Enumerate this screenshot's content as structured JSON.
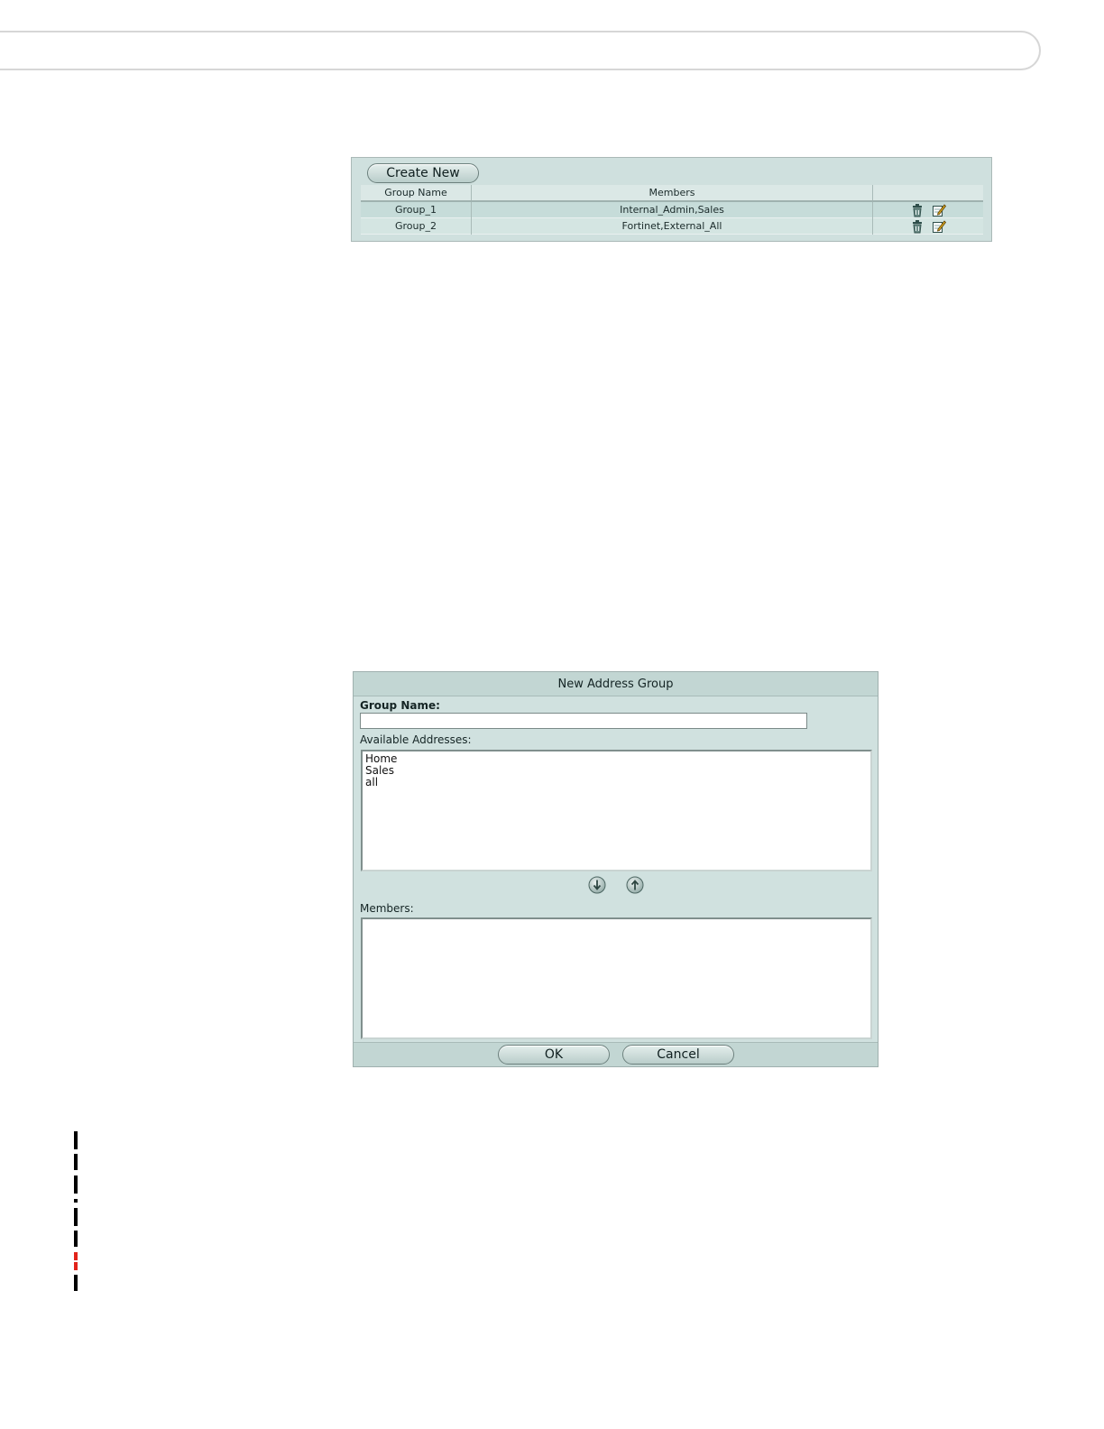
{
  "address_group_list": {
    "create_new_label": "Create New",
    "columns": [
      "Group Name",
      "Members",
      ""
    ],
    "rows": [
      {
        "group_name": "Group_1",
        "members": "Internal_Admin,Sales"
      },
      {
        "group_name": "Group_2",
        "members": "Fortinet,External_All"
      }
    ],
    "row_action_icons": [
      "delete-icon",
      "edit-icon"
    ]
  },
  "new_address_group_dialog": {
    "title": "New Address Group",
    "group_name_label": "Group Name:",
    "group_name_value": "",
    "available_label": "Available Addresses:",
    "available_options": [
      "Home",
      "Sales",
      "all"
    ],
    "arrow_icons": [
      "arrow-down-icon",
      "arrow-up-icon"
    ],
    "members_label": "Members:",
    "member_options": [],
    "ok_label": "OK",
    "cancel_label": "Cancel"
  },
  "logo": {
    "text": "FORTINET",
    "colors": {
      "letters": "#000000",
      "accent": "#e2231a"
    }
  },
  "theme": {
    "panel_bg": "#cfe0de",
    "header_bg": "#c2d6d3",
    "button_border": "#6c807d"
  }
}
